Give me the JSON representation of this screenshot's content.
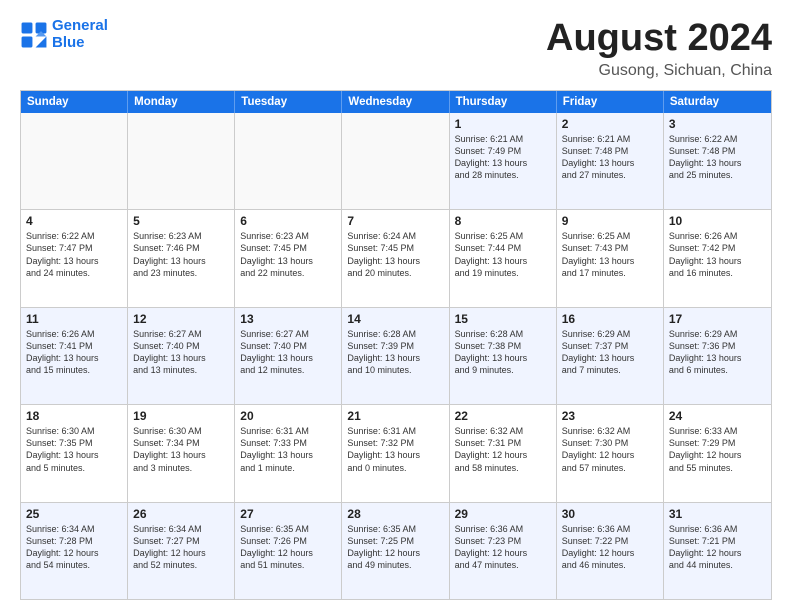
{
  "logo": {
    "line1": "General",
    "line2": "Blue"
  },
  "title": "August 2024",
  "subtitle": "Gusong, Sichuan, China",
  "days": [
    "Sunday",
    "Monday",
    "Tuesday",
    "Wednesday",
    "Thursday",
    "Friday",
    "Saturday"
  ],
  "rows": [
    [
      {
        "num": "",
        "info": "",
        "empty": true
      },
      {
        "num": "",
        "info": "",
        "empty": true
      },
      {
        "num": "",
        "info": "",
        "empty": true
      },
      {
        "num": "",
        "info": "",
        "empty": true
      },
      {
        "num": "1",
        "info": "Sunrise: 6:21 AM\nSunset: 7:49 PM\nDaylight: 13 hours\nand 28 minutes."
      },
      {
        "num": "2",
        "info": "Sunrise: 6:21 AM\nSunset: 7:48 PM\nDaylight: 13 hours\nand 27 minutes."
      },
      {
        "num": "3",
        "info": "Sunrise: 6:22 AM\nSunset: 7:48 PM\nDaylight: 13 hours\nand 25 minutes."
      }
    ],
    [
      {
        "num": "4",
        "info": "Sunrise: 6:22 AM\nSunset: 7:47 PM\nDaylight: 13 hours\nand 24 minutes."
      },
      {
        "num": "5",
        "info": "Sunrise: 6:23 AM\nSunset: 7:46 PM\nDaylight: 13 hours\nand 23 minutes."
      },
      {
        "num": "6",
        "info": "Sunrise: 6:23 AM\nSunset: 7:45 PM\nDaylight: 13 hours\nand 22 minutes."
      },
      {
        "num": "7",
        "info": "Sunrise: 6:24 AM\nSunset: 7:45 PM\nDaylight: 13 hours\nand 20 minutes."
      },
      {
        "num": "8",
        "info": "Sunrise: 6:25 AM\nSunset: 7:44 PM\nDaylight: 13 hours\nand 19 minutes."
      },
      {
        "num": "9",
        "info": "Sunrise: 6:25 AM\nSunset: 7:43 PM\nDaylight: 13 hours\nand 17 minutes."
      },
      {
        "num": "10",
        "info": "Sunrise: 6:26 AM\nSunset: 7:42 PM\nDaylight: 13 hours\nand 16 minutes."
      }
    ],
    [
      {
        "num": "11",
        "info": "Sunrise: 6:26 AM\nSunset: 7:41 PM\nDaylight: 13 hours\nand 15 minutes."
      },
      {
        "num": "12",
        "info": "Sunrise: 6:27 AM\nSunset: 7:40 PM\nDaylight: 13 hours\nand 13 minutes."
      },
      {
        "num": "13",
        "info": "Sunrise: 6:27 AM\nSunset: 7:40 PM\nDaylight: 13 hours\nand 12 minutes."
      },
      {
        "num": "14",
        "info": "Sunrise: 6:28 AM\nSunset: 7:39 PM\nDaylight: 13 hours\nand 10 minutes."
      },
      {
        "num": "15",
        "info": "Sunrise: 6:28 AM\nSunset: 7:38 PM\nDaylight: 13 hours\nand 9 minutes."
      },
      {
        "num": "16",
        "info": "Sunrise: 6:29 AM\nSunset: 7:37 PM\nDaylight: 13 hours\nand 7 minutes."
      },
      {
        "num": "17",
        "info": "Sunrise: 6:29 AM\nSunset: 7:36 PM\nDaylight: 13 hours\nand 6 minutes."
      }
    ],
    [
      {
        "num": "18",
        "info": "Sunrise: 6:30 AM\nSunset: 7:35 PM\nDaylight: 13 hours\nand 5 minutes."
      },
      {
        "num": "19",
        "info": "Sunrise: 6:30 AM\nSunset: 7:34 PM\nDaylight: 13 hours\nand 3 minutes."
      },
      {
        "num": "20",
        "info": "Sunrise: 6:31 AM\nSunset: 7:33 PM\nDaylight: 13 hours\nand 1 minute."
      },
      {
        "num": "21",
        "info": "Sunrise: 6:31 AM\nSunset: 7:32 PM\nDaylight: 13 hours\nand 0 minutes."
      },
      {
        "num": "22",
        "info": "Sunrise: 6:32 AM\nSunset: 7:31 PM\nDaylight: 12 hours\nand 58 minutes."
      },
      {
        "num": "23",
        "info": "Sunrise: 6:32 AM\nSunset: 7:30 PM\nDaylight: 12 hours\nand 57 minutes."
      },
      {
        "num": "24",
        "info": "Sunrise: 6:33 AM\nSunset: 7:29 PM\nDaylight: 12 hours\nand 55 minutes."
      }
    ],
    [
      {
        "num": "25",
        "info": "Sunrise: 6:34 AM\nSunset: 7:28 PM\nDaylight: 12 hours\nand 54 minutes."
      },
      {
        "num": "26",
        "info": "Sunrise: 6:34 AM\nSunset: 7:27 PM\nDaylight: 12 hours\nand 52 minutes."
      },
      {
        "num": "27",
        "info": "Sunrise: 6:35 AM\nSunset: 7:26 PM\nDaylight: 12 hours\nand 51 minutes."
      },
      {
        "num": "28",
        "info": "Sunrise: 6:35 AM\nSunset: 7:25 PM\nDaylight: 12 hours\nand 49 minutes."
      },
      {
        "num": "29",
        "info": "Sunrise: 6:36 AM\nSunset: 7:23 PM\nDaylight: 12 hours\nand 47 minutes."
      },
      {
        "num": "30",
        "info": "Sunrise: 6:36 AM\nSunset: 7:22 PM\nDaylight: 12 hours\nand 46 minutes."
      },
      {
        "num": "31",
        "info": "Sunrise: 6:36 AM\nSunset: 7:21 PM\nDaylight: 12 hours\nand 44 minutes."
      }
    ]
  ],
  "alt_rows": [
    0,
    2,
    4
  ]
}
